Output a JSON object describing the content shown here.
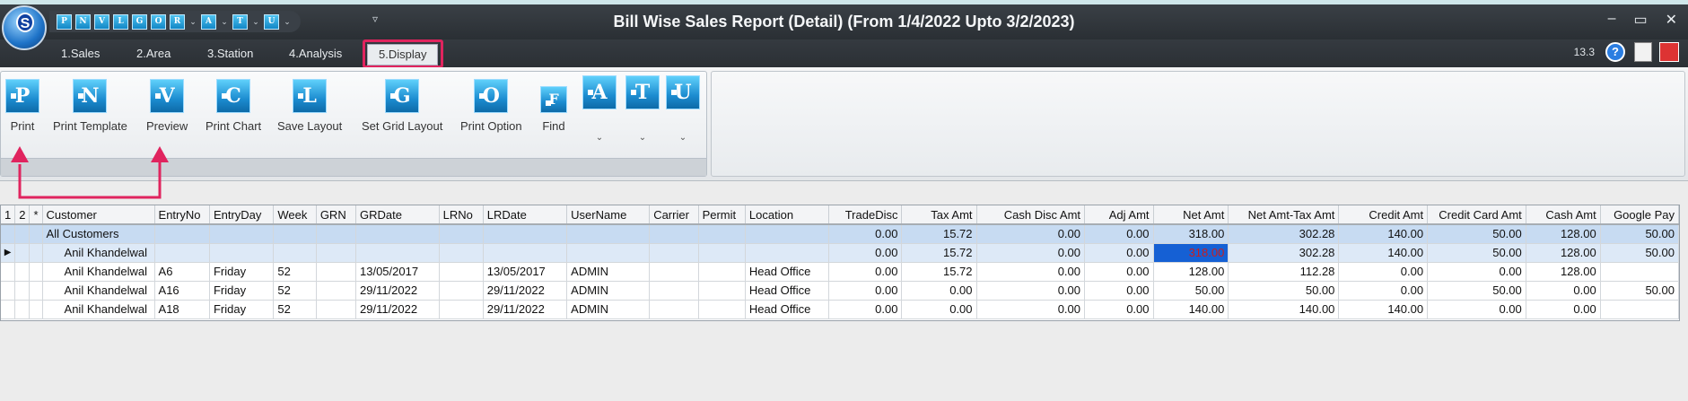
{
  "app": {
    "title": "Bill Wise Sales Report (Detail) (From 1/4/2022 Upto 3/2/2023)",
    "logo_letter": "S",
    "version": "13.3",
    "help_label": "?"
  },
  "quick_access": {
    "buttons": [
      "P",
      "N",
      "V",
      "L",
      "G",
      "O",
      "R",
      "A",
      "T",
      "U"
    ],
    "more_label": "▿"
  },
  "window_controls": {
    "minimize": "–",
    "restore": "▭",
    "close": "✕"
  },
  "tabs": [
    "1.Sales",
    "2.Area",
    "3.Station",
    "4.Analysis",
    "5.Display"
  ],
  "active_tab": "5.Display",
  "ribbon": {
    "buttons": [
      {
        "letter": "P",
        "label": "Print"
      },
      {
        "letter": "N",
        "label": "Print Template"
      },
      {
        "letter": "V",
        "label": "Preview"
      },
      {
        "letter": "C",
        "label": "Print Chart"
      },
      {
        "letter": "L",
        "label": "Save Layout"
      },
      {
        "letter": "G",
        "label": "Set Grid Layout"
      },
      {
        "letter": "O",
        "label": "Print Option"
      },
      {
        "letter": "F",
        "label": "Find"
      }
    ],
    "dropdown_buttons": [
      {
        "letter": "A",
        "arrow": "⌄"
      },
      {
        "letter": "T",
        "arrow": "⌄"
      },
      {
        "letter": "U",
        "arrow": "⌄"
      }
    ]
  },
  "grid": {
    "level_markers": [
      "1",
      "2",
      "*"
    ],
    "columns": [
      "Customer",
      "EntryNo",
      "EntryDay",
      "Week",
      "GRN",
      "GRDate",
      "LRNo",
      "LRDate",
      "UserName",
      "Carrier",
      "Permit",
      "Location",
      "TradeDisc",
      "Tax Amt",
      "Cash Disc Amt",
      "Adj Amt",
      "Net Amt",
      "Net Amt-Tax Amt",
      "Credit Amt",
      "Credit Card Amt",
      "Cash Amt",
      "Google Pay"
    ],
    "rows": [
      [
        "All Customers",
        "",
        "",
        "",
        "",
        "",
        "",
        "",
        "",
        "",
        "",
        "",
        "0.00",
        "15.72",
        "0.00",
        "0.00",
        "318.00",
        "302.28",
        "140.00",
        "50.00",
        "128.00",
        "50.00"
      ],
      [
        "Anil Khandelwal",
        "",
        "",
        "",
        "",
        "",
        "",
        "",
        "",
        "",
        "",
        "",
        "0.00",
        "15.72",
        "0.00",
        "0.00",
        "318.00",
        "302.28",
        "140.00",
        "50.00",
        "128.00",
        "50.00"
      ],
      [
        "Anil Khandelwal",
        "A6",
        "Friday",
        "52",
        "",
        "13/05/2017",
        "",
        "13/05/2017",
        "ADMIN",
        "",
        "",
        "Head Office",
        "0.00",
        "15.72",
        "0.00",
        "0.00",
        "128.00",
        "112.28",
        "0.00",
        "0.00",
        "128.00",
        ""
      ],
      [
        "Anil Khandelwal",
        "A16",
        "Friday",
        "52",
        "",
        "29/11/2022",
        "",
        "29/11/2022",
        "ADMIN",
        "",
        "",
        "Head Office",
        "0.00",
        "0.00",
        "0.00",
        "0.00",
        "50.00",
        "50.00",
        "0.00",
        "50.00",
        "0.00",
        "50.00"
      ],
      [
        "Anil Khandelwal",
        "A18",
        "Friday",
        "52",
        "",
        "29/11/2022",
        "",
        "29/11/2022",
        "ADMIN",
        "",
        "",
        "Head Office",
        "0.00",
        "0.00",
        "0.00",
        "0.00",
        "140.00",
        "140.00",
        "140.00",
        "0.00",
        "0.00",
        ""
      ]
    ],
    "current_row_marker": "▶"
  },
  "colors": {
    "accent_highlight": "#e0245e",
    "selected_cell_bg": "#1560d4",
    "group_row_bg": "#c7dbf2"
  }
}
